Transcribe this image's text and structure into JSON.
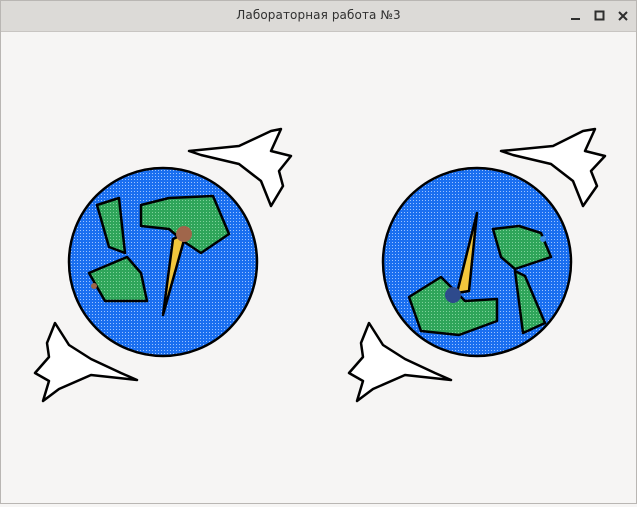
{
  "window": {
    "title": "Лабораторная работа №3"
  },
  "controls": {
    "minimize_icon": "minimize-icon",
    "maximize_icon": "maximize-icon",
    "close_icon": "close-icon"
  },
  "scene": {
    "ocean_color": "#1a6ff0",
    "land_color": "#2fa55a",
    "hand_color": "#f2c63c",
    "bird_color": "#ffffff",
    "outline_color": "#000000",
    "left_pivot_color": "#a0664b",
    "right_pivot_color": "#2e4a8c"
  }
}
